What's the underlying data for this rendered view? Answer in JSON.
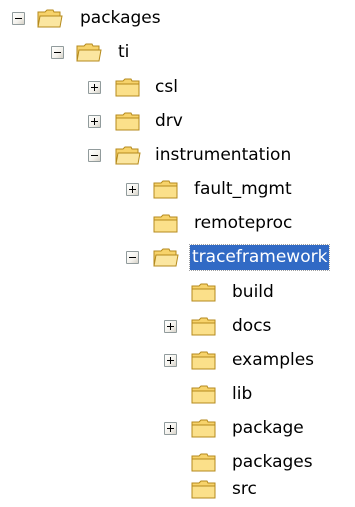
{
  "tree": {
    "items": [
      {
        "label": "packages",
        "expander": "minus",
        "folder": "open"
      },
      {
        "label": "ti",
        "expander": "minus",
        "folder": "open"
      },
      {
        "label": "csl",
        "expander": "plus",
        "folder": "closed"
      },
      {
        "label": "drv",
        "expander": "plus",
        "folder": "closed"
      },
      {
        "label": "instrumentation",
        "expander": "minus",
        "folder": "open"
      },
      {
        "label": "fault_mgmt",
        "expander": "plus",
        "folder": "closed"
      },
      {
        "label": "remoteproc",
        "expander": "none",
        "folder": "closed"
      },
      {
        "label": "traceframework",
        "expander": "minus",
        "folder": "open",
        "selected": true
      },
      {
        "label": "build",
        "expander": "none",
        "folder": "closed"
      },
      {
        "label": "docs",
        "expander": "plus",
        "folder": "closed"
      },
      {
        "label": "examples",
        "expander": "plus",
        "folder": "closed"
      },
      {
        "label": "lib",
        "expander": "none",
        "folder": "closed"
      },
      {
        "label": "package",
        "expander": "plus",
        "folder": "closed"
      },
      {
        "label": "packages",
        "expander": "none",
        "folder": "closed"
      },
      {
        "label": "src",
        "expander": "none",
        "folder": "closed"
      }
    ]
  },
  "colors": {
    "selection_bg": "#316ac5",
    "selection_text": "#ffffff",
    "folder_fill": "#f7d36b",
    "folder_outline": "#b58a1c"
  },
  "icons": {
    "expander_plus": "plus-box-icon",
    "expander_minus": "minus-box-icon",
    "folder_open": "folder-open-icon",
    "folder_closed": "folder-icon"
  }
}
